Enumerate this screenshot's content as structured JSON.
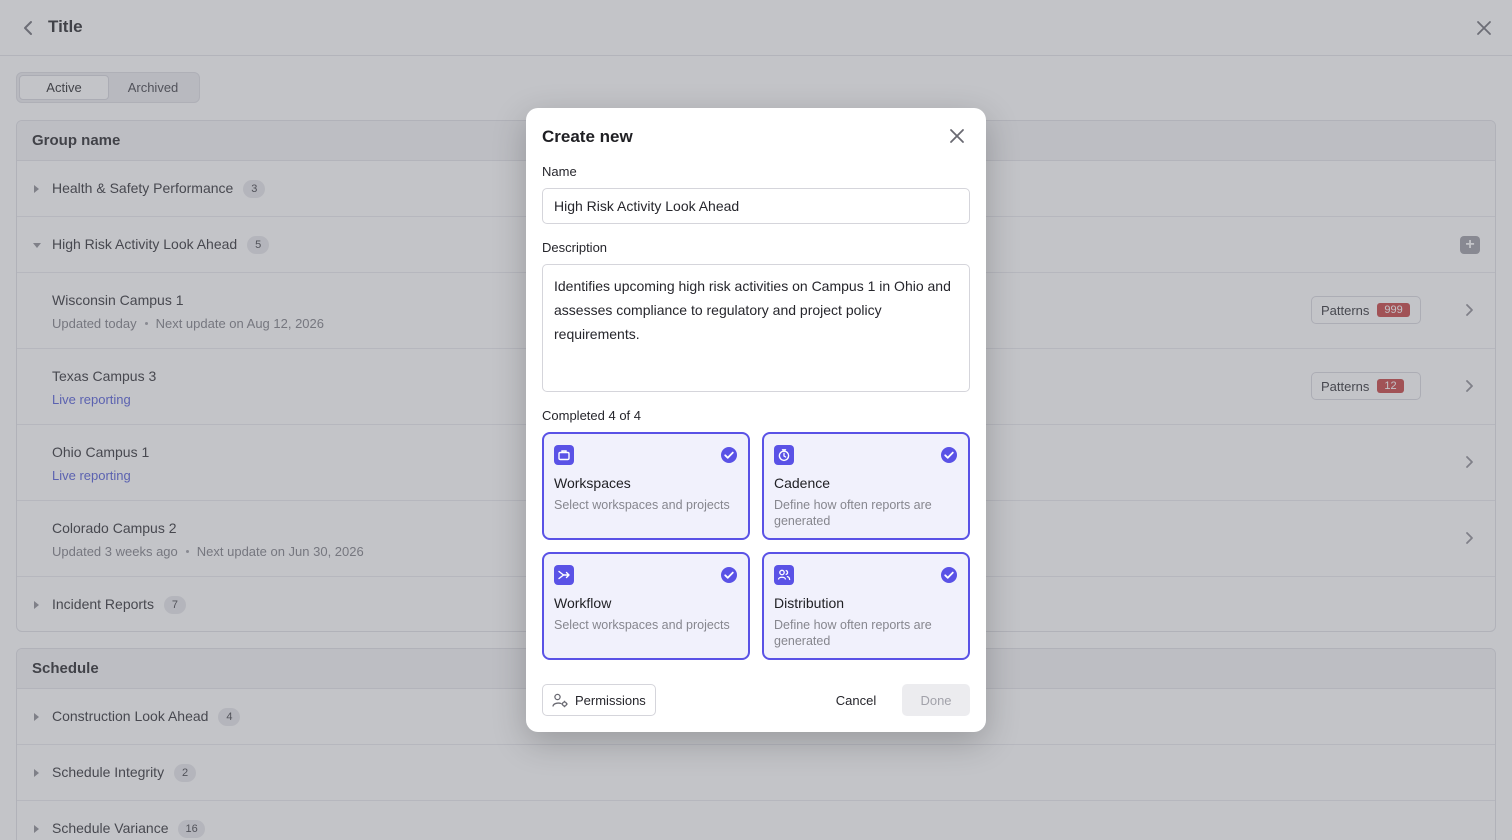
{
  "header": {
    "title": "Title"
  },
  "tabs": [
    {
      "label": "Active",
      "active": true
    },
    {
      "label": "Archived",
      "active": false
    }
  ],
  "group_panel": {
    "title": "Group name",
    "groups": [
      {
        "name": "Health & Safety Performance",
        "count": "3",
        "expanded": false
      },
      {
        "name": "High Risk Activity Look Ahead",
        "count": "5",
        "expanded": true
      },
      {
        "name": "Incident Reports",
        "count": "7",
        "expanded": false
      }
    ],
    "items": [
      {
        "name": "Wisconsin Campus 1",
        "updated": "Updated today",
        "next": "Next update on Aug 12, 2026",
        "patterns_label": "Patterns",
        "patterns_count": "999"
      },
      {
        "name": "Texas Campus 3",
        "live": "Live reporting",
        "patterns_label": "Patterns",
        "patterns_count": "12"
      },
      {
        "name": "Ohio Campus 1",
        "live": "Live reporting"
      },
      {
        "name": "Colorado Campus 2",
        "updated": "Updated 3 weeks ago",
        "next": "Next update on Jun 30, 2026"
      }
    ]
  },
  "schedule_panel": {
    "title": "Schedule",
    "groups": [
      {
        "name": "Construction Look Ahead",
        "count": "4"
      },
      {
        "name": "Schedule Integrity",
        "count": "2"
      },
      {
        "name": "Schedule Variance",
        "count": "16"
      }
    ]
  },
  "modal": {
    "title": "Create new",
    "name_label": "Name",
    "name_value": "High Risk Activity Look Ahead",
    "description_label": "Description",
    "description_value": "Identifies upcoming high risk activities on Campus 1 in Ohio and assesses compliance to regulatory and project policy requirements.",
    "progress": "Completed 4 of 4",
    "cards": [
      {
        "title": "Workspaces",
        "desc": "Select workspaces and projects",
        "icon": "briefcase-icon",
        "done": true
      },
      {
        "title": "Cadence",
        "desc": "Define how often reports are generated",
        "icon": "stopwatch-icon",
        "done": true
      },
      {
        "title": "Workflow",
        "desc": "Select workspaces and projects",
        "icon": "merge-arrow-icon",
        "done": true
      },
      {
        "title": "Distribution",
        "desc": "Define how often reports are generated",
        "icon": "users-icon",
        "done": true
      }
    ],
    "permissions_label": "Permissions",
    "cancel_label": "Cancel",
    "done_label": "Done"
  },
  "colors": {
    "accent": "#5a52e6",
    "danger": "#c43b3b",
    "link": "#4c56d6"
  }
}
